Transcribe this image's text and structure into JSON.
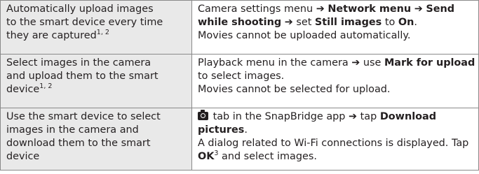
{
  "rows": [
    {
      "description": {
        "line1": "Automatically upload images",
        "line2": "to the smart device every time",
        "line3": "they are captured",
        "sup": "1, 2"
      },
      "procedure": {
        "p1": "Camera settings menu",
        "arrow1": "➔",
        "b1": "Network menu",
        "arrow2": "➔",
        "b2": "Send",
        "b3": "while shooting",
        "arrow3": "➔",
        "t2": "set",
        "b4": "Still images",
        "t3": "to",
        "b5": "On",
        "t4": ".",
        "note": "Movies cannot be uploaded automatically."
      }
    },
    {
      "description": {
        "line1": "Select images in the camera",
        "line2": "and upload them to the smart",
        "line3": "device",
        "sup": "1, 2"
      },
      "procedure": {
        "p1": "Playback menu in the camera",
        "arrow1": "➔",
        "t2": "use",
        "b1": "Mark for upload",
        "t3": "to select images.",
        "note": "Movies cannot be selected for upload."
      }
    },
    {
      "description": {
        "line1": "Use the smart device to select",
        "line2": "images in the camera and",
        "line3": "download them to the smart",
        "line4": "device"
      },
      "procedure": {
        "icon": "camera-icon",
        "t1": "tab in the SnapBridge app",
        "arrow1": "➔",
        "t2": "tap",
        "b1": "Download",
        "b2": "pictures",
        "t3": ".",
        "t4": "A dialog related to Wi-Fi connections is displayed. Tap",
        "b3": "OK",
        "sup": "3",
        "t5": "and select images."
      }
    }
  ]
}
